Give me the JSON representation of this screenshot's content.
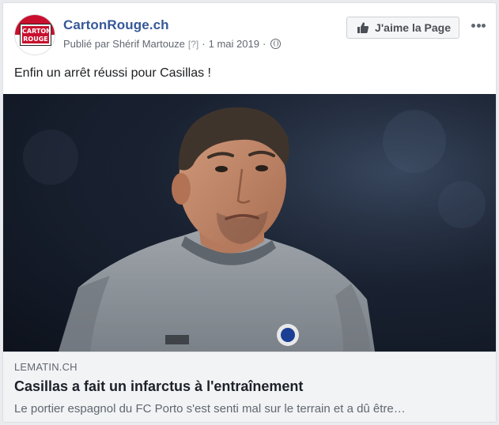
{
  "page": {
    "name": "CartonRouge.ch",
    "logo_text": "CARTON ROUGE"
  },
  "meta": {
    "published_by": "Publié par Shérif Martouze",
    "bracket": "[?]",
    "separator": "·",
    "date": "1 mai 2019",
    "audience_icon": "globe-icon"
  },
  "actions": {
    "like_page_label": "J'aime la Page",
    "like_icon": "thumbs-up-icon",
    "more_icon": "ellipsis-icon"
  },
  "post": {
    "text": "Enfin un arrêt réussi pour Casillas !"
  },
  "link": {
    "domain": "LEMATIN.CH",
    "title": "Casillas a fait un infarctus à l'entraînement",
    "description": "Le portier espagnol du FC Porto s'est senti mal sur le terrain et a dû être…"
  },
  "colors": {
    "brand_link": "#365899",
    "logo_red": "#c8102e",
    "meta_gray": "#616770",
    "card_bg": "#ffffff",
    "link_box_bg": "#f2f3f5"
  }
}
